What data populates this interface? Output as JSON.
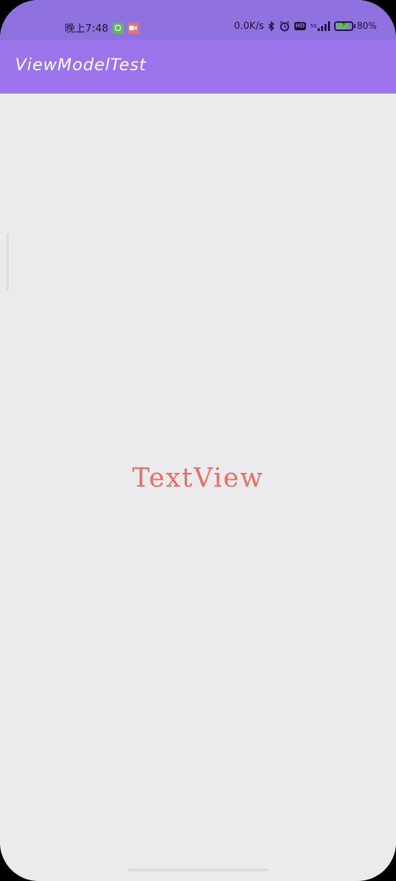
{
  "status_bar": {
    "time": "晚上7:48",
    "notifications": [
      {
        "icon": "wechat-icon"
      },
      {
        "icon": "video-call-icon"
      }
    ],
    "network_speed": "0.0K/s",
    "icons": [
      "bluetooth-icon",
      "alarm-icon",
      "hd-icon",
      "signal-icon"
    ],
    "hd_label": "HD",
    "signal_label": "5G",
    "battery_percent": "80",
    "battery_level": 0.8,
    "battery_charging": true
  },
  "app_bar": {
    "title": "ViewModelTest"
  },
  "main": {
    "text_view": "TextView"
  },
  "colors": {
    "status_bar": "#8f72e0",
    "app_bar": "#9b74ec",
    "background": "#ebebed",
    "text_view": "#e96f62"
  }
}
